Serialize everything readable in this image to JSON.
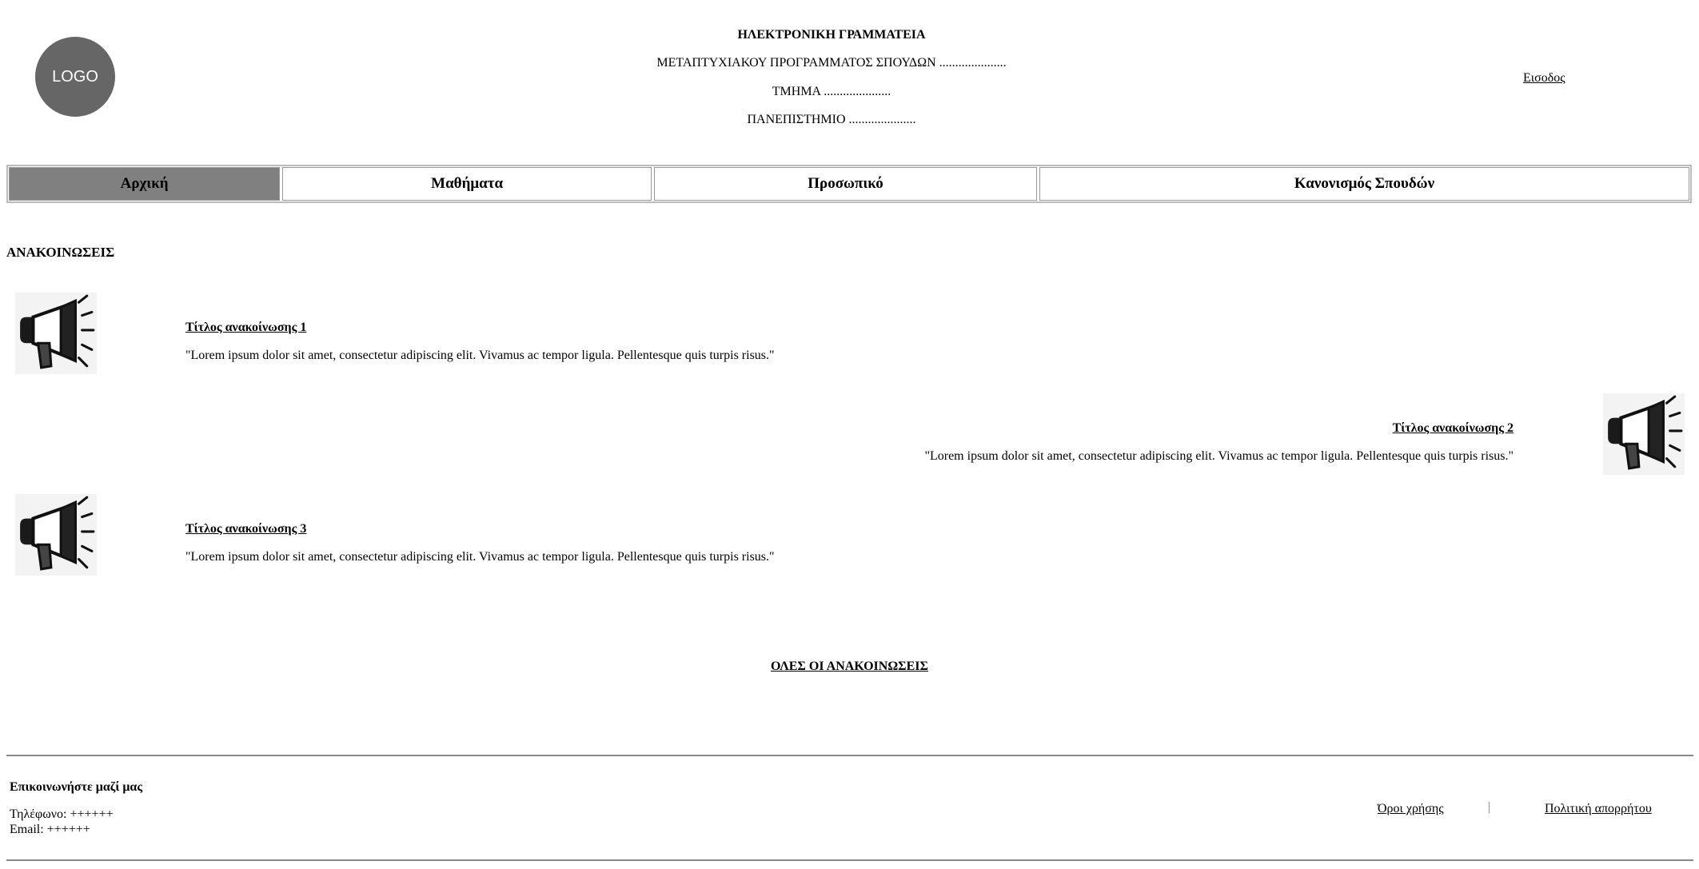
{
  "header": {
    "logo_text": "LOGO",
    "line1": "ΗΛΕΚΤΡΟΝΙΚΗ ΓΡΑΜΜΑΤΕΙΑ",
    "line2": "ΜΕΤΑΠΤΥΧΙΑΚΟΥ ΠΡΟΓΡΑΜΜΑΤΟΣ ΣΠΟΥΔΩΝ .....................",
    "line3": "ΤΜΗΜΑ .....................",
    "line4": "ΠΑΝΕΠΙΣΤΗΜΙΟ .....................",
    "login": "Εισοδος"
  },
  "nav": {
    "items": [
      {
        "label": "Αρχική",
        "active": true
      },
      {
        "label": "Μαθήματα",
        "active": false
      },
      {
        "label": "Προσωπικό",
        "active": false
      },
      {
        "label": "Κανονισμός Σπουδών",
        "active": false
      }
    ]
  },
  "announcements": {
    "title": "ΑΝΑΚΟΙΝΩΣΕΙΣ",
    "icon": "megaphone-icon",
    "items": [
      {
        "title": "Τίτλος ανακοίνωσης 1",
        "text": "\"Lorem ipsum dolor sit amet, consectetur adipiscing elit. Vivamus ac tempor ligula. Pellentesque quis turpis risus.\""
      },
      {
        "title": "Τίτλος ανακοίνωσης 2",
        "text": "\"Lorem ipsum dolor sit amet, consectetur adipiscing elit. Vivamus ac tempor ligula. Pellentesque quis turpis risus.\""
      },
      {
        "title": "Τίτλος ανακοίνωσης 3",
        "text": "\"Lorem ipsum dolor sit amet, consectetur adipiscing elit. Vivamus ac tempor ligula. Pellentesque quis turpis risus.\""
      }
    ],
    "all_link": "ΟΛΕΣ ΟΙ ΑΝΑΚΟΙΝΩΣΕΙΣ"
  },
  "footer": {
    "contact_title": "Επικοινωνήστε μαζί μας",
    "phone": "Τηλέφωνο: ++++++",
    "email": "Email: ++++++",
    "terms": "Όροι χρήσης",
    "separator": "|",
    "privacy": "Πολιτική απορρήτου"
  },
  "colors": {
    "active_tab": "#808080",
    "logo": "#666666"
  }
}
